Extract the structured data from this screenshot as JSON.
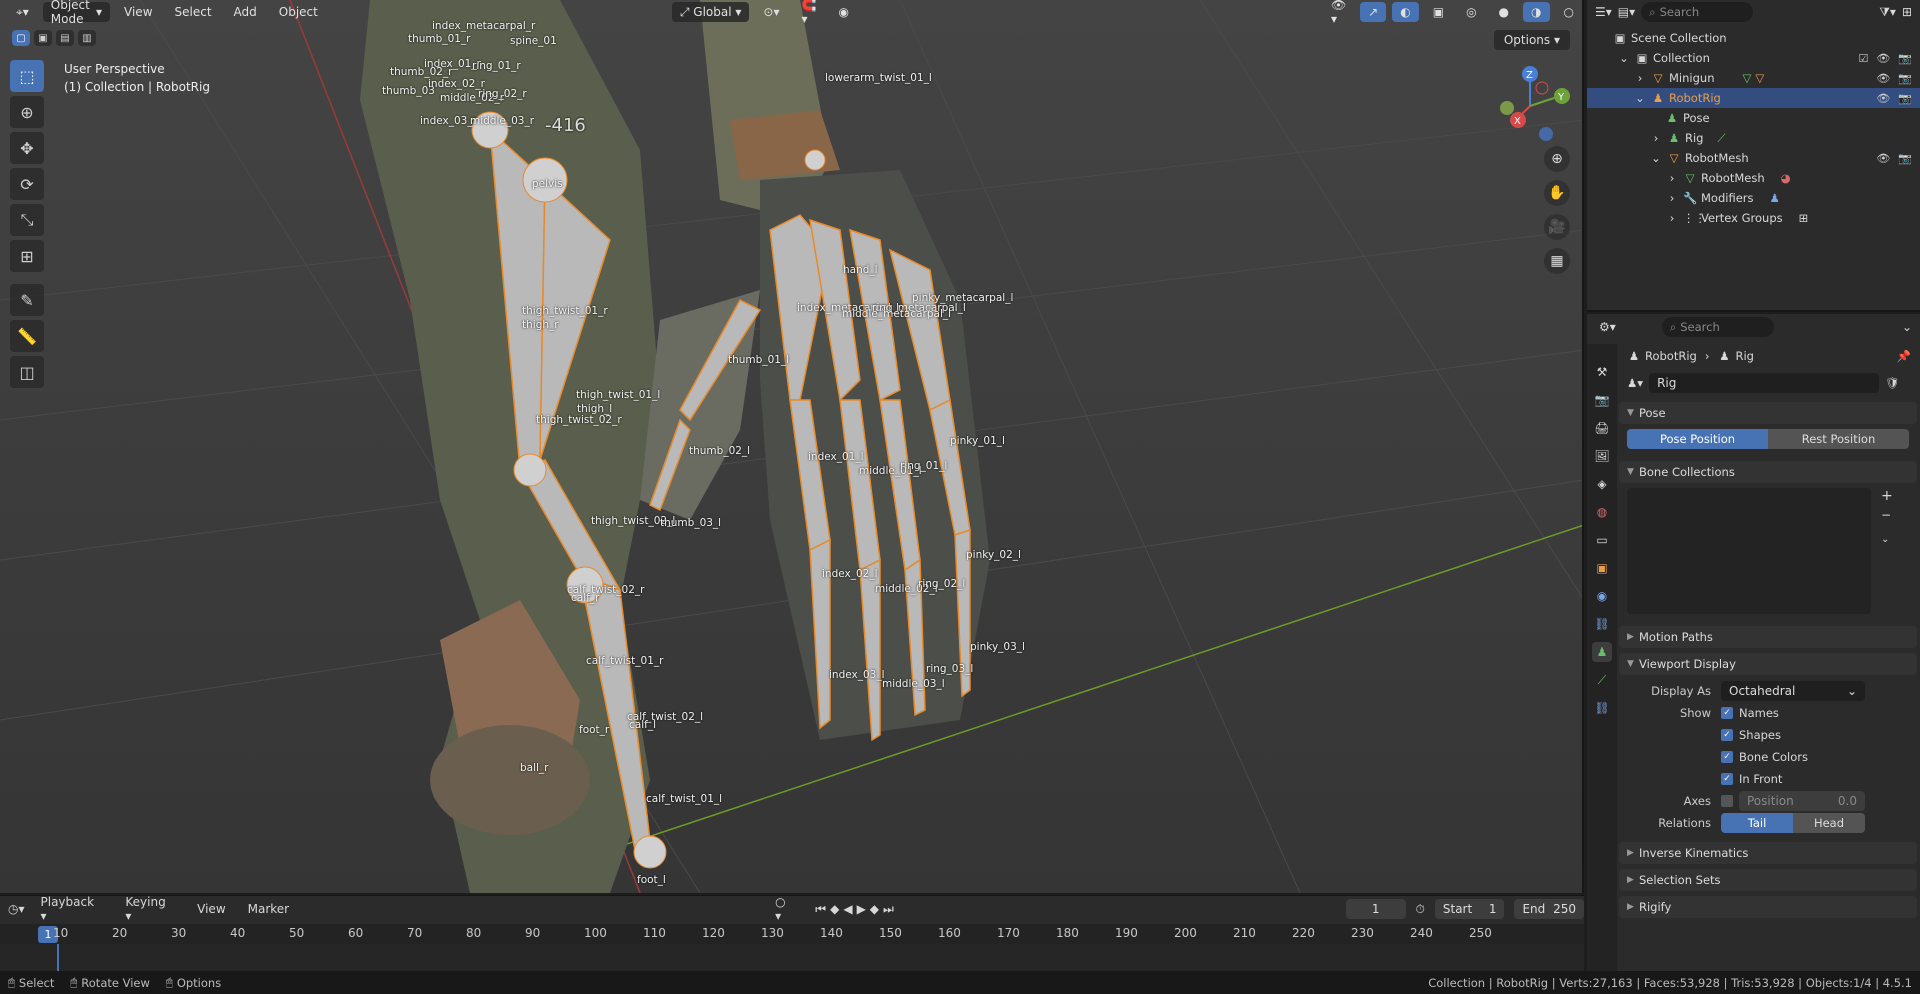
{
  "header": {
    "mode": "Object Mode",
    "menus": [
      "View",
      "Select",
      "Add",
      "Object"
    ],
    "transform": "Global",
    "options": "Options"
  },
  "viewport": {
    "perspective": "User Perspective",
    "collection_line": "(1) Collection | RobotRig",
    "bone_labels": [
      "thumb_01_r",
      "index_metacarpal_r",
      "spine_01",
      "index_01_r",
      "ring_01_r",
      "thumb_02_r",
      "middle_02_r",
      "thumb_03",
      "index_02_r",
      "ring_02_r",
      "index_03_r",
      "middle_03_r",
      "lowerarm_twist_01_l",
      "pelvis",
      "-416",
      "hand_l",
      "pinky_metacarpal_l",
      "index_metacarpal_l",
      "ring_metacarpal_l",
      "middle_metacarpal_l",
      "thigh_twist_01_r",
      "thigh_r",
      "thumb_01_l",
      "thigh_twist_01_l",
      "thigh_l",
      "thigh_twist_02_r",
      "pinky_01_l",
      "thumb_02_l",
      "index_01_l",
      "middle_01_l",
      "ring_01_l",
      "thigh_twist_02_l",
      "thumb_03_l",
      "pinky_02_l",
      "index_02_l",
      "middle_02_l",
      "ring_02_l",
      "calf_twist_02_r",
      "calf_r",
      "pinky_03_l",
      "calf_twist_01_r",
      "index_03_l",
      "ring_03_l",
      "middle_03_l",
      "calf_twist_02_l",
      "calf_l",
      "foot_r",
      "ball_r",
      "calf_twist_01_l",
      "foot_l"
    ]
  },
  "timeline": {
    "menus": [
      "Playback",
      "Keying",
      "View",
      "Marker"
    ],
    "current_frame": "1",
    "start_label": "Start",
    "start": "1",
    "end_label": "End",
    "end": "250",
    "ticks": [
      "1",
      "10",
      "20",
      "30",
      "40",
      "50",
      "60",
      "70",
      "80",
      "90",
      "100",
      "110",
      "120",
      "130",
      "140",
      "150",
      "160",
      "170",
      "180",
      "190",
      "200",
      "210",
      "220",
      "230",
      "240",
      "250"
    ]
  },
  "statusbar": {
    "select": "Select",
    "rotate": "Rotate View",
    "options": "Options",
    "stats": "Collection | RobotRig | Verts:27,163 | Faces:53,928 | Tris:53,928 | Objects:1/4 | 4.5.1"
  },
  "outliner": {
    "search_placeholder": "Search",
    "rows": [
      {
        "label": "Scene Collection"
      },
      {
        "label": "Collection"
      },
      {
        "label": "Minigun"
      },
      {
        "label": "RobotRig"
      },
      {
        "label": "Pose"
      },
      {
        "label": "Rig"
      },
      {
        "label": "RobotMesh"
      },
      {
        "label": "RobotMesh"
      },
      {
        "label": "Modifiers"
      },
      {
        "label": "Vertex Groups"
      }
    ]
  },
  "properties": {
    "search_placeholder": "Search",
    "breadcrumb_object": "RobotRig",
    "breadcrumb_data": "Rig",
    "datablock_name": "Rig",
    "pose_panel": "Pose",
    "pose_position": "Pose Position",
    "rest_position": "Rest Position",
    "bone_collections": "Bone Collections",
    "motion_paths": "Motion Paths",
    "viewport_display": "Viewport Display",
    "display_as_label": "Display As",
    "display_as_value": "Octahedral",
    "show_label": "Show",
    "show_names": "Names",
    "show_shapes": "Shapes",
    "show_bone_colors": "Bone Colors",
    "show_in_front": "In Front",
    "axes_label": "Axes",
    "axes_position_label": "Position",
    "axes_position_value": "0.0",
    "relations_label": "Relations",
    "relations_tail": "Tail",
    "relations_head": "Head",
    "inverse_kinematics": "Inverse Kinematics",
    "selection_sets": "Selection Sets",
    "rigify": "Rigify"
  }
}
